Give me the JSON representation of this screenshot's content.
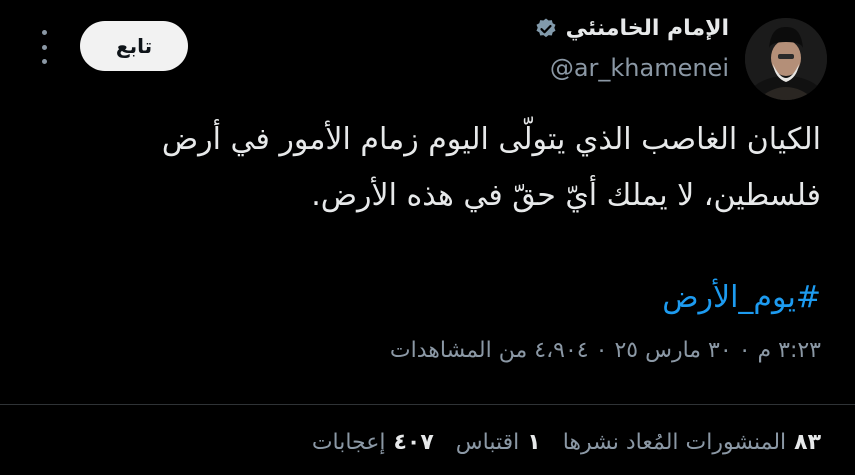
{
  "user": {
    "name": "الإمام الخامنئي",
    "handle": "@ar_khamenei"
  },
  "follow_label": "تابع",
  "tweet": {
    "text_line1": "الكيان الغاصب الذي يتولّى اليوم زمام الأمور في أرض",
    "text_line2": "فلسطين، لا يملك أيّ حقّ في هذه الأرض.",
    "hashtag": "#يوم_الأرض"
  },
  "meta": "٣:٢٣ م ٠ ٣٠ مارس ٢٥ ٠ ٤،٩٠٤ من المشاهدات",
  "stats": [
    {
      "num": "٨٣",
      "label": "المنشورات المُعاد نشرها"
    },
    {
      "num": "١",
      "label": "اقتباس"
    },
    {
      "num": "٤٠٧",
      "label": "إعجابات"
    }
  ],
  "colors": {
    "background": "#000000",
    "text": "#e7e9ea",
    "muted": "#8b98a5",
    "link": "#1d9bf0"
  }
}
